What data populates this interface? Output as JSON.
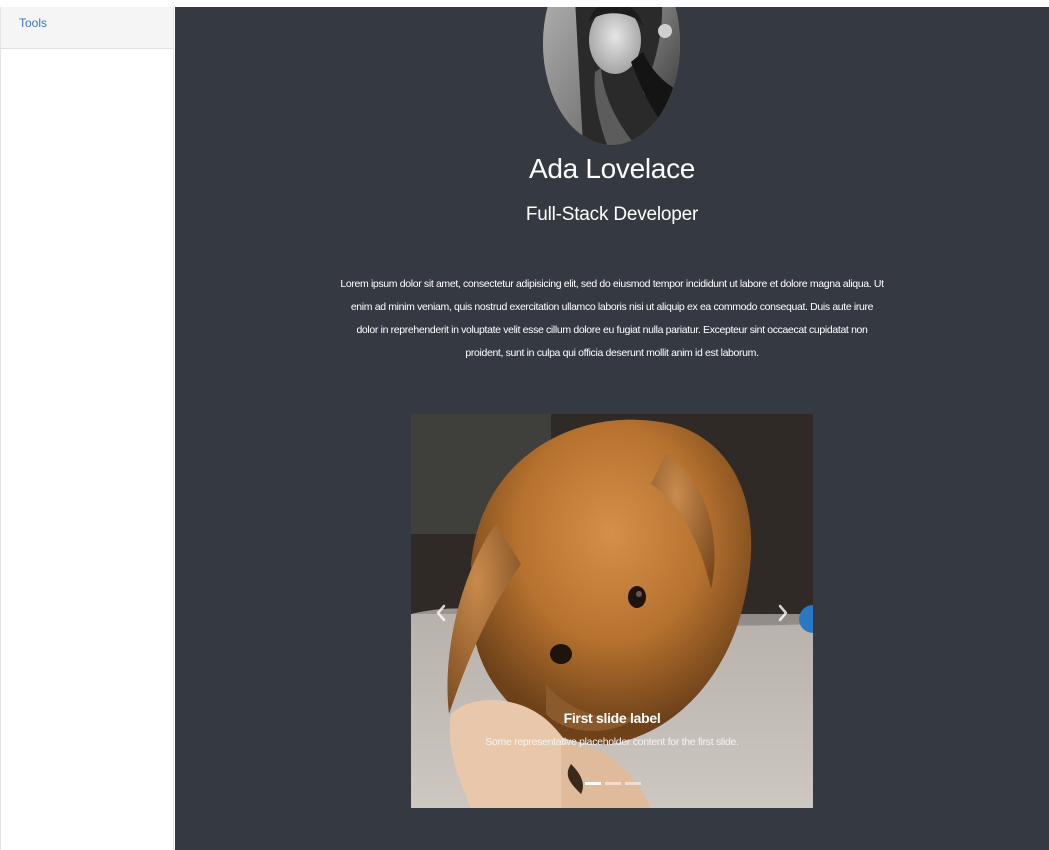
{
  "sidebar": {
    "tools_label": "Tools"
  },
  "profile": {
    "name": "Ada Lovelace",
    "role": "Full-Stack Developer",
    "bio": "Lorem ipsum dolor sit amet, consectetur adipisicing elit, sed do eiusmod tempor incididunt ut labore et dolore magna aliqua. Ut enim ad minim veniam, quis nostrud exercitation ullamco laboris nisi ut aliquip ex ea commodo consequat. Duis aute irure dolor in reprehenderit in voluptate velit esse cillum dolore eu fugiat nulla pariatur. Excepteur sint occaecat cupidatat non proident, sunt in culpa qui officia deserunt mollit anim id est laborum."
  },
  "carousel": {
    "caption_title": "First slide label",
    "caption_text": "Some representative placeholder content for the first slide.",
    "prev_icon": "chevron-left-icon",
    "next_icon": "chevron-right-icon",
    "slide_count": 3,
    "active_slide": 1
  },
  "colors": {
    "main_bg": "#353a42",
    "link": "#3b78c9",
    "sidebar_header_bg": "#f5f5f5"
  }
}
